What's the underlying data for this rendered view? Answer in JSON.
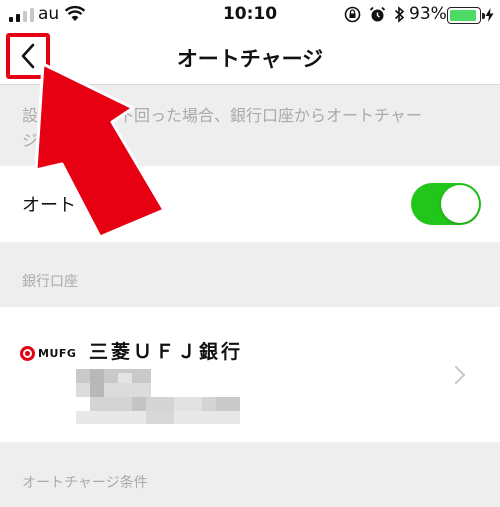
{
  "status_bar": {
    "carrier": "au",
    "time": "10:10",
    "battery_percent": "93%",
    "battery_level": 0.93,
    "signal_bars_active": 2,
    "icons": [
      "signal-icon",
      "wifi-icon",
      "rotation-lock-icon",
      "alarm-icon",
      "bluetooth-icon",
      "battery-icon",
      "charging-icon"
    ]
  },
  "nav": {
    "title": "オートチャージ",
    "back_icon": "chevron-left-icon"
  },
  "description": {
    "line1": "設　　　額を下回った場合、銀行口座からオートチャー",
    "line2": "ジ　　　。"
  },
  "auto_charge": {
    "label": "オート　　　ジ",
    "enabled": true
  },
  "bank_section": {
    "header": "銀行口座",
    "bank_logo_text": "MUFG",
    "bank_name": "三菱ＵＦＪ銀行"
  },
  "conditions_section": {
    "header": "オートチャージ条件"
  },
  "colors": {
    "accent_red": "#e60012",
    "toggle_on": "#22c61a",
    "battery": "#4cd964",
    "section_bg": "#eeeeef",
    "muted_text": "#aaaaaa"
  },
  "annotation": {
    "type": "arrow",
    "color": "#e60012",
    "points_to": "back-button"
  }
}
